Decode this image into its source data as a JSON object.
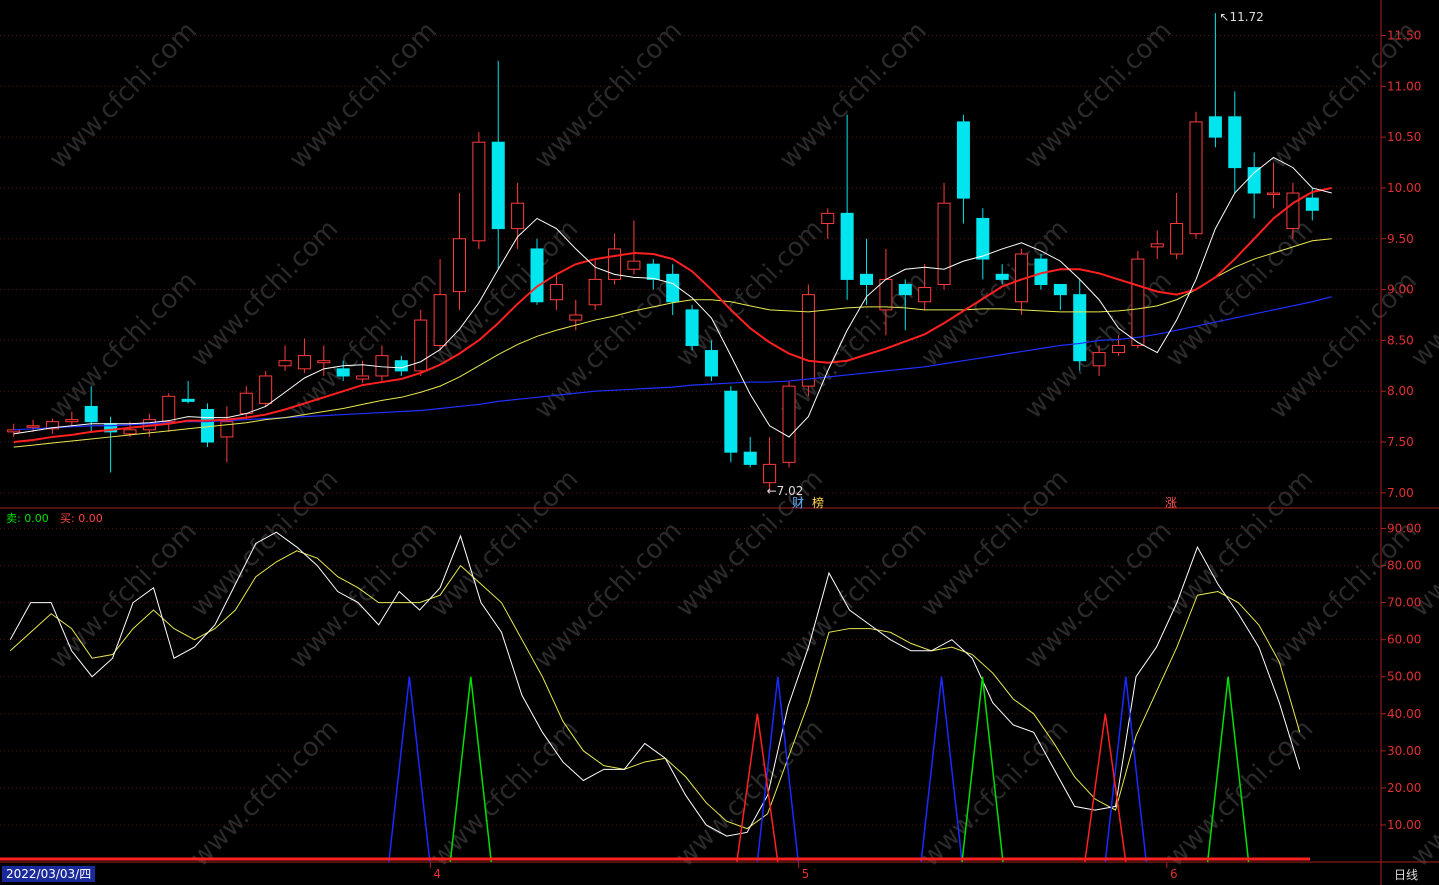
{
  "watermark_text": "www.cfchi.com",
  "legend": {
    "sell_label": "卖:",
    "sell_value": "0.00",
    "buy_label": "买:",
    "buy_value": "0.00"
  },
  "footer": {
    "date": "2022/03/03/四",
    "period": "日线"
  },
  "events": {
    "cai": "财",
    "bang": "榜",
    "zhang": "涨"
  },
  "colors": {
    "up": "#ff3b3b",
    "down": "#00e5ee",
    "ma5": "#ffffff",
    "ma10": "#ff2020",
    "ma20": "#e8e850",
    "ma60": "#2030ff",
    "axis": "#aa2222",
    "k_line": "#ffffff",
    "d_line": "#e8e850",
    "sig_blue": "#1a2aff",
    "sig_green": "#00e000",
    "sig_red": "#ff2020"
  },
  "chart_data": [
    {
      "type": "candlestick",
      "title": "",
      "ylim": [
        6.9,
        11.8
      ],
      "y_ticks": [
        "7.00",
        "7.50",
        "8.00",
        "8.50",
        "9.00",
        "9.50",
        "10.00",
        "10.50",
        "11.00",
        "11.50"
      ],
      "x_ticks": [
        "4",
        "5",
        "6"
      ],
      "annotations": {
        "high": "11.72",
        "low": "7.02"
      },
      "candles": [
        [
          7.6,
          7.62,
          7.68,
          7.55
        ],
        [
          7.65,
          7.66,
          7.72,
          7.6
        ],
        [
          7.63,
          7.7,
          7.73,
          7.58
        ],
        [
          7.7,
          7.72,
          7.8,
          7.65
        ],
        [
          7.85,
          7.7,
          8.05,
          7.6
        ],
        [
          7.68,
          7.6,
          7.75,
          7.2
        ],
        [
          7.58,
          7.62,
          7.7,
          7.55
        ],
        [
          7.62,
          7.72,
          7.78,
          7.55
        ],
        [
          7.7,
          7.95,
          7.98,
          7.6
        ],
        [
          7.92,
          7.9,
          8.1,
          7.88
        ],
        [
          7.82,
          7.5,
          7.88,
          7.45
        ],
        [
          7.55,
          7.7,
          7.85,
          7.3
        ],
        [
          7.78,
          7.98,
          8.05,
          7.72
        ],
        [
          7.88,
          8.15,
          8.2,
          7.85
        ],
        [
          8.25,
          8.3,
          8.45,
          8.2
        ],
        [
          8.22,
          8.35,
          8.52,
          8.18
        ],
        [
          8.28,
          8.3,
          8.45,
          8.15
        ],
        [
          8.22,
          8.15,
          8.3,
          8.1
        ],
        [
          8.12,
          8.15,
          8.3,
          8.08
        ],
        [
          8.15,
          8.35,
          8.45,
          8.1
        ],
        [
          8.3,
          8.2,
          8.35,
          8.15
        ],
        [
          8.2,
          8.7,
          8.8,
          8.15
        ],
        [
          8.45,
          8.95,
          9.3,
          8.4
        ],
        [
          8.98,
          9.5,
          9.95,
          8.8
        ],
        [
          9.48,
          10.45,
          10.55,
          9.4
        ],
        [
          10.45,
          9.6,
          11.25,
          9.2
        ],
        [
          9.6,
          9.85,
          10.05,
          9.4
        ],
        [
          9.4,
          8.88,
          9.5,
          8.85
        ],
        [
          8.9,
          9.05,
          9.15,
          8.8
        ],
        [
          8.7,
          8.75,
          8.9,
          8.6
        ],
        [
          8.85,
          9.1,
          9.3,
          8.8
        ],
        [
          9.1,
          9.4,
          9.55,
          9.05
        ],
        [
          9.2,
          9.28,
          9.68,
          9.15
        ],
        [
          9.25,
          9.1,
          9.3,
          9.0
        ],
        [
          9.15,
          8.88,
          9.25,
          8.75
        ],
        [
          8.8,
          8.45,
          8.85,
          8.4
        ],
        [
          8.4,
          8.15,
          8.5,
          8.1
        ],
        [
          8.0,
          7.4,
          8.05,
          7.3
        ],
        [
          7.4,
          7.28,
          7.55,
          7.25
        ],
        [
          7.1,
          7.28,
          7.55,
          7.02
        ],
        [
          7.3,
          8.05,
          8.1,
          7.25
        ],
        [
          8.05,
          8.95,
          9.05,
          7.95
        ],
        [
          9.65,
          9.75,
          9.8,
          9.5
        ],
        [
          9.75,
          9.1,
          10.72,
          8.9
        ],
        [
          9.15,
          9.05,
          9.5,
          8.85
        ],
        [
          8.8,
          9.1,
          9.4,
          8.55
        ],
        [
          9.05,
          8.95,
          9.1,
          8.6
        ],
        [
          8.88,
          9.02,
          9.25,
          8.8
        ],
        [
          9.05,
          9.85,
          10.05,
          9.0
        ],
        [
          10.65,
          9.9,
          10.72,
          9.65
        ],
        [
          9.7,
          9.3,
          9.8,
          9.1
        ],
        [
          9.15,
          9.1,
          9.25,
          9.05
        ],
        [
          8.88,
          9.35,
          9.4,
          8.75
        ],
        [
          9.3,
          9.05,
          9.35,
          9.0
        ],
        [
          9.05,
          8.95,
          9.05,
          8.8
        ],
        [
          8.95,
          8.3,
          9.1,
          8.2
        ],
        [
          8.25,
          8.38,
          8.45,
          8.15
        ],
        [
          8.38,
          8.45,
          8.55,
          8.35
        ],
        [
          8.45,
          9.3,
          9.38,
          8.42
        ],
        [
          9.42,
          9.45,
          9.58,
          9.3
        ],
        [
          9.35,
          9.65,
          9.95,
          9.3
        ],
        [
          9.55,
          10.65,
          10.75,
          9.5
        ],
        [
          10.7,
          10.5,
          11.72,
          10.4
        ],
        [
          10.7,
          10.2,
          10.95,
          9.95
        ],
        [
          10.2,
          9.95,
          10.35,
          9.7
        ],
        [
          9.95,
          9.95,
          10.25,
          9.8
        ],
        [
          9.6,
          9.95,
          10.05,
          9.5
        ],
        [
          9.9,
          9.78,
          10.0,
          9.68
        ]
      ],
      "ma5": [
        7.58,
        7.61,
        7.64,
        7.66,
        7.68,
        7.68,
        7.68,
        7.69,
        7.71,
        7.75,
        7.74,
        7.74,
        7.78,
        7.85,
        7.99,
        8.13,
        8.22,
        8.25,
        8.26,
        8.24,
        8.23,
        8.29,
        8.41,
        8.61,
        8.87,
        9.2,
        9.52,
        9.7,
        9.6,
        9.4,
        9.22,
        9.15,
        9.12,
        9.11,
        9.06,
        8.92,
        8.72,
        8.35,
        7.97,
        7.66,
        7.55,
        7.75,
        8.2,
        8.6,
        8.93,
        9.1,
        9.2,
        9.22,
        9.2,
        9.28,
        9.33,
        9.4,
        9.46,
        9.38,
        9.28,
        9.1,
        8.9,
        8.62,
        8.48,
        8.38,
        8.7,
        9.1,
        9.6,
        9.95,
        10.15,
        10.3,
        10.2,
        10.0,
        9.95
      ],
      "ma10": [
        7.5,
        7.52,
        7.55,
        7.57,
        7.6,
        7.62,
        7.64,
        7.66,
        7.68,
        7.71,
        7.71,
        7.72,
        7.74,
        7.77,
        7.82,
        7.88,
        7.94,
        8.0,
        8.06,
        8.09,
        8.12,
        8.18,
        8.26,
        8.37,
        8.5,
        8.67,
        8.86,
        9.03,
        9.15,
        9.25,
        9.3,
        9.33,
        9.36,
        9.35,
        9.3,
        9.18,
        9.0,
        8.8,
        8.62,
        8.48,
        8.37,
        8.3,
        8.28,
        8.3,
        8.36,
        8.42,
        8.49,
        8.56,
        8.67,
        8.79,
        8.91,
        9.03,
        9.1,
        9.16,
        9.2,
        9.2,
        9.16,
        9.1,
        9.04,
        8.98,
        8.95,
        9.0,
        9.12,
        9.3,
        9.5,
        9.7,
        9.85,
        9.96,
        10.0
      ],
      "ma20": [
        7.45,
        7.47,
        7.49,
        7.51,
        7.53,
        7.55,
        7.57,
        7.59,
        7.61,
        7.63,
        7.65,
        7.67,
        7.69,
        7.72,
        7.74,
        7.77,
        7.8,
        7.83,
        7.87,
        7.91,
        7.94,
        7.99,
        8.05,
        8.14,
        8.25,
        8.36,
        8.46,
        8.54,
        8.6,
        8.65,
        8.7,
        8.74,
        8.79,
        8.83,
        8.87,
        8.9,
        8.9,
        8.88,
        8.84,
        8.8,
        8.79,
        8.78,
        8.8,
        8.82,
        8.83,
        8.83,
        8.82,
        8.8,
        8.8,
        8.8,
        8.81,
        8.81,
        8.8,
        8.79,
        8.78,
        8.78,
        8.78,
        8.79,
        8.81,
        8.84,
        8.9,
        9.0,
        9.12,
        9.22,
        9.3,
        9.36,
        9.42,
        9.48,
        9.5
      ],
      "ma60": [
        7.62,
        7.63,
        7.64,
        7.65,
        7.66,
        7.66,
        7.67,
        7.68,
        7.69,
        7.7,
        7.7,
        7.71,
        7.72,
        7.73,
        7.74,
        7.75,
        7.76,
        7.77,
        7.78,
        7.79,
        7.8,
        7.81,
        7.83,
        7.85,
        7.87,
        7.9,
        7.92,
        7.94,
        7.96,
        7.98,
        8.0,
        8.01,
        8.02,
        8.03,
        8.04,
        8.06,
        8.07,
        8.08,
        8.09,
        8.09,
        8.1,
        8.12,
        8.14,
        8.16,
        8.18,
        8.2,
        8.22,
        8.24,
        8.27,
        8.3,
        8.33,
        8.36,
        8.39,
        8.42,
        8.45,
        8.47,
        8.5,
        8.51,
        8.53,
        8.56,
        8.6,
        8.64,
        8.68,
        8.72,
        8.76,
        8.8,
        8.84,
        8.88,
        8.93
      ]
    },
    {
      "type": "line",
      "title": "",
      "ylim": [
        0,
        95
      ],
      "y_ticks": [
        "10.00",
        "20.00",
        "30.00",
        "40.00",
        "50.00",
        "60.00",
        "70.00",
        "80.00",
        "90.00"
      ],
      "k": [
        60,
        70,
        70,
        57,
        50,
        55,
        70,
        74,
        55,
        58,
        64,
        75,
        86,
        89,
        85,
        80,
        73,
        70,
        64,
        73,
        68,
        74,
        88,
        70,
        62,
        45,
        35,
        27,
        22,
        25,
        25,
        32,
        28,
        18,
        10,
        7,
        8,
        18,
        42,
        58,
        78,
        68,
        64,
        60,
        57,
        57,
        60,
        55,
        43,
        37,
        35,
        25,
        15,
        14,
        15,
        50,
        58,
        70,
        85,
        75,
        67,
        58,
        43,
        25
      ],
      "d": [
        57,
        62,
        67,
        63,
        55,
        56,
        63,
        68,
        63,
        60,
        63,
        68,
        77,
        81,
        84,
        82,
        77,
        74,
        70,
        70,
        70,
        72,
        80,
        75,
        70,
        60,
        50,
        38,
        30,
        26,
        25,
        27,
        28,
        23,
        16,
        11,
        9,
        13,
        28,
        43,
        62,
        63,
        63,
        62,
        59,
        57,
        58,
        56,
        51,
        44,
        40,
        32,
        23,
        17,
        14,
        34,
        46,
        58,
        72,
        73,
        70,
        64,
        54,
        35
      ],
      "signals_blue": [
        {
          "x": 19.5,
          "value": 50
        },
        {
          "x": 37.5,
          "value": 50
        },
        {
          "x": 45.5,
          "value": 50
        },
        {
          "x": 54.5,
          "value": 50
        }
      ],
      "signals_green": [
        {
          "x": 22.5,
          "value": 50
        },
        {
          "x": 47.5,
          "value": 50
        },
        {
          "x": 59.5,
          "value": 50
        }
      ],
      "signals_red": [
        {
          "x": 36.5,
          "value": 40
        },
        {
          "x": 53.5,
          "value": 40
        }
      ]
    }
  ]
}
